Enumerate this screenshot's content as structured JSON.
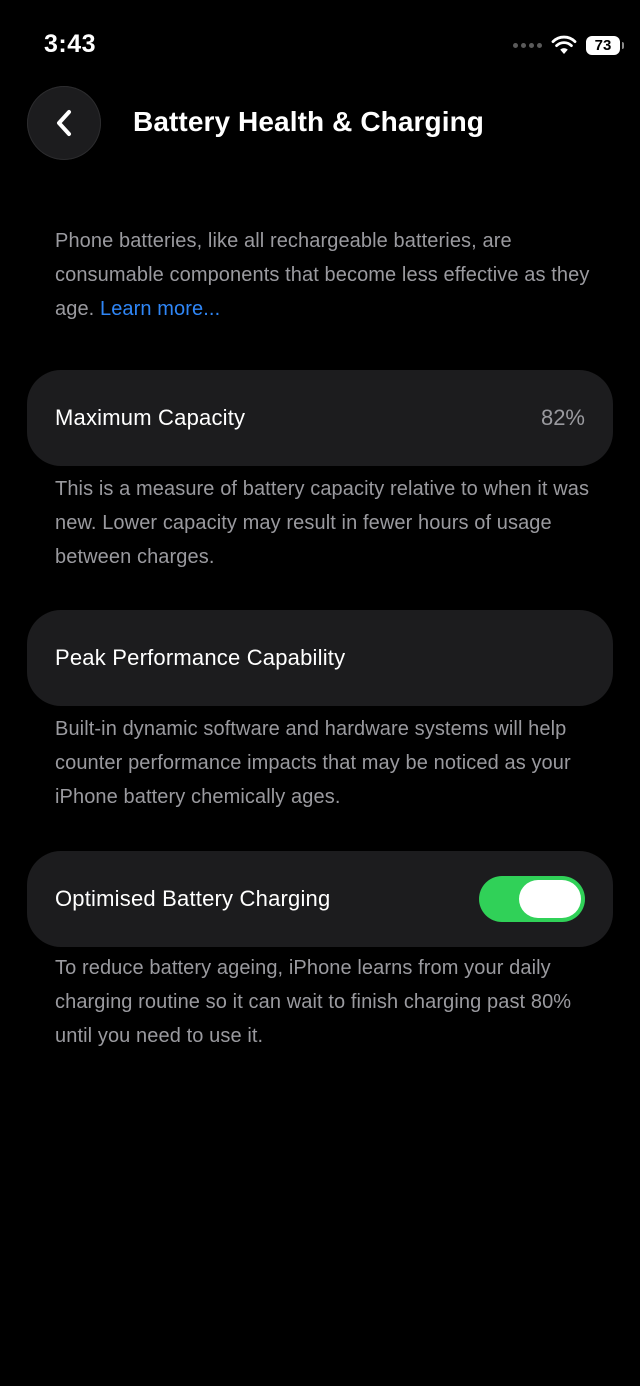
{
  "status_bar": {
    "time": "3:43",
    "battery_level": "73",
    "icons": [
      "signal-dots-icon",
      "wifi-icon",
      "battery-icon"
    ]
  },
  "nav": {
    "back_icon": "chevron-left-icon",
    "title": "Battery Health & Charging"
  },
  "intro": {
    "text": "Phone batteries, like all rechargeable batteries, are consumable components that become less effective as they age. ",
    "link": "Learn more..."
  },
  "maximum_capacity": {
    "label": "Maximum Capacity",
    "value": "82%",
    "description": "This is a measure of battery capacity relative to when it was new. Lower capacity may result in fewer hours of usage between charges."
  },
  "peak_performance": {
    "label": "Peak Performance Capability",
    "description": "Built-in dynamic software and hardware systems will help counter performance impacts that may be noticed as your iPhone battery chemically ages."
  },
  "optimised_charging": {
    "label": "Optimised Battery Charging",
    "enabled": true,
    "description": "To reduce battery ageing, iPhone learns from your daily charging routine so it can wait to finish charging past 80% until you need to use it."
  },
  "colors": {
    "background": "#000000",
    "card": "#1c1c1e",
    "accent_link": "#2f86f6",
    "toggle_on": "#30d158",
    "secondary_text": "#9a9a9f"
  }
}
